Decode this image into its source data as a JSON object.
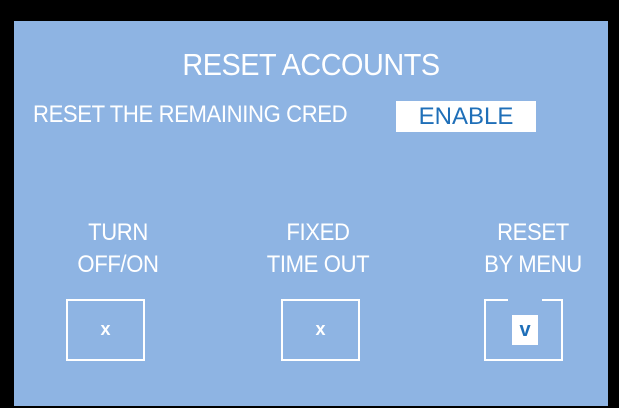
{
  "screen": {
    "title": "RESET ACCOUNTS",
    "setting": {
      "label": "RESET THE REMAINING CRED",
      "value": "ENABLE"
    },
    "options": [
      {
        "line1": "TURN",
        "line2": "OFF/ON",
        "mark": "x",
        "selected": false
      },
      {
        "line1": "FIXED",
        "line2": "TIME OUT",
        "mark": "x",
        "selected": false
      },
      {
        "line1": "RESET",
        "line2": "BY MENU",
        "mark": "v",
        "selected": true
      }
    ]
  },
  "colors": {
    "background": "#8eb4e3",
    "frame": "#000000",
    "text": "#ffffff",
    "accent": "#1f6fb8"
  }
}
